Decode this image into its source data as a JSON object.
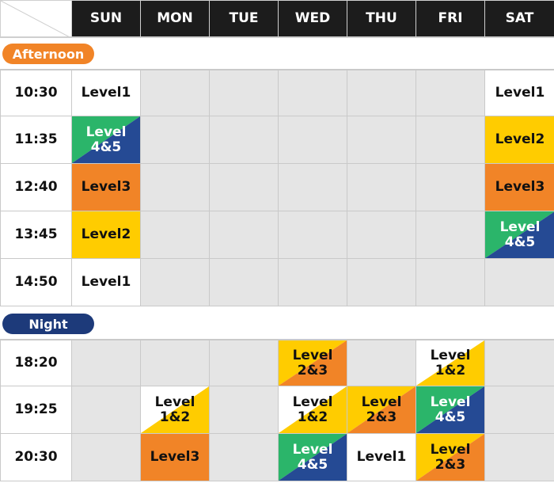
{
  "colors": {
    "level1": "#ffffff",
    "level2": "#ffcc00",
    "level3": "#f18427",
    "level4": "#2bb56a",
    "level5": "#254a94",
    "header_bg": "#1c1c1c",
    "empty_cell": "#e5e5e5",
    "afternoon_badge": "#f18427",
    "night_badge": "#1d3a7a"
  },
  "days": [
    "SUN",
    "MON",
    "TUE",
    "WED",
    "THU",
    "FRI",
    "SAT"
  ],
  "sections": [
    {
      "label": "Afternoon",
      "rows": [
        {
          "time": "10:30",
          "cells": [
            {
              "text": [
                "Level1"
              ],
              "style": "white"
            },
            null,
            null,
            null,
            null,
            null,
            {
              "text": [
                "Level1"
              ],
              "style": "white"
            }
          ]
        },
        {
          "time": "11:35",
          "cells": [
            {
              "text": [
                "Level",
                "4&5"
              ],
              "style": "green-blue"
            },
            null,
            null,
            null,
            null,
            null,
            {
              "text": [
                "Level2"
              ],
              "style": "yellow"
            }
          ]
        },
        {
          "time": "12:40",
          "cells": [
            {
              "text": [
                "Level3"
              ],
              "style": "orange"
            },
            null,
            null,
            null,
            null,
            null,
            {
              "text": [
                "Level3"
              ],
              "style": "orange"
            }
          ]
        },
        {
          "time": "13:45",
          "cells": [
            {
              "text": [
                "Level2"
              ],
              "style": "yellow"
            },
            null,
            null,
            null,
            null,
            null,
            {
              "text": [
                "Level",
                "4&5"
              ],
              "style": "green-blue"
            }
          ]
        },
        {
          "time": "14:50",
          "cells": [
            {
              "text": [
                "Level1"
              ],
              "style": "white"
            },
            null,
            null,
            null,
            null,
            null,
            null
          ]
        }
      ]
    },
    {
      "label": "Night",
      "rows": [
        {
          "time": "18:20",
          "cells": [
            null,
            null,
            null,
            {
              "text": [
                "Level",
                "2&3"
              ],
              "style": "yellow-orange"
            },
            null,
            {
              "text": [
                "Level",
                "1&2"
              ],
              "style": "white-yellow"
            },
            null
          ]
        },
        {
          "time": "19:25",
          "cells": [
            null,
            {
              "text": [
                "Level",
                "1&2"
              ],
              "style": "white-yellow"
            },
            null,
            {
              "text": [
                "Level",
                "1&2"
              ],
              "style": "white-yellow"
            },
            {
              "text": [
                "Level",
                "2&3"
              ],
              "style": "yellow-orange"
            },
            {
              "text": [
                "Level",
                "4&5"
              ],
              "style": "green-blue"
            },
            null
          ]
        },
        {
          "time": "20:30",
          "cells": [
            null,
            {
              "text": [
                "Level3"
              ],
              "style": "orange"
            },
            null,
            {
              "text": [
                "Level",
                "4&5"
              ],
              "style": "green-blue"
            },
            {
              "text": [
                "Level1"
              ],
              "style": "white"
            },
            {
              "text": [
                "Level",
                "2&3"
              ],
              "style": "yellow-orange"
            },
            null
          ]
        }
      ]
    }
  ]
}
